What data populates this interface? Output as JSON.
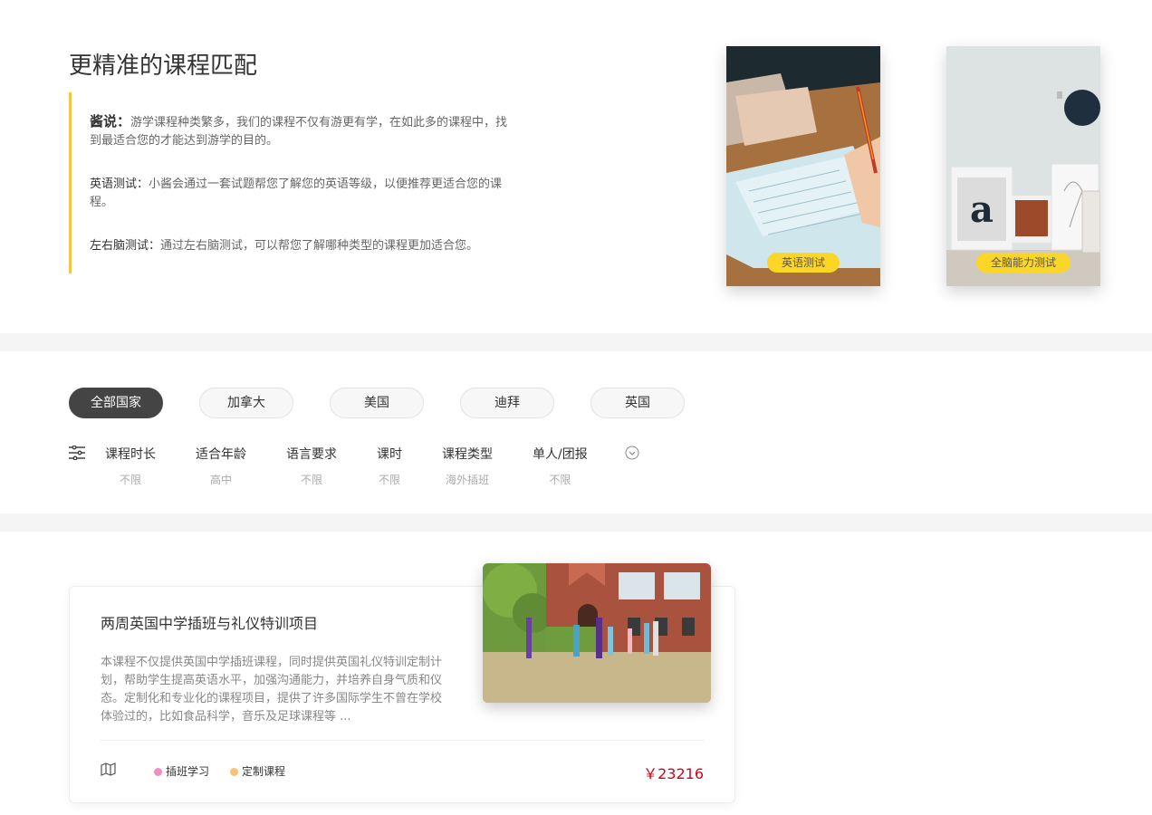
{
  "intro": {
    "title": "更精准的课程匹配",
    "p1_label": "酱说：",
    "p1_text": "游学课程种类繁多，我们的课程不仅有游更有学，在如此多的课程中，找到最适合您的才能达到游学的目的。",
    "p2_label": "英语测试：",
    "p2_text": "小酱会通过一套试题帮您了解您的英语等级，以便推荐更适合您的课程。",
    "p3_label": "左右脑测试：",
    "p3_text": "通过左右脑测试，可以帮您了解哪种类型的课程更加适合您。"
  },
  "tests": [
    {
      "label": "英语测试"
    },
    {
      "label": "全脑能力测试"
    }
  ],
  "countries": [
    "全部国家",
    "加拿大",
    "美国",
    "迪拜",
    "英国"
  ],
  "filters": [
    {
      "label": "课程时长",
      "value": "不限"
    },
    {
      "label": "适合年龄",
      "value": "高中"
    },
    {
      "label": "语言要求",
      "value": "不限"
    },
    {
      "label": "课时",
      "value": "不限"
    },
    {
      "label": "课程类型",
      "value": "海外插班"
    },
    {
      "label": "单人/团报",
      "value": "不限"
    }
  ],
  "course": {
    "title": "两周英国中学插班与礼仪特训项目",
    "description": "本课程不仅提供英国中学插班课程，同时提供英国礼仪特训定制计划，帮助学生提高英语水平，加强沟通能力，并培养自身气质和仪态。定制化和专业化的课程项目，提供了许多国际学生不曾在学校体验过的，比如食品科学，音乐及足球课程等 ...",
    "tags": [
      {
        "label": "插班学习",
        "color": "#f08fbf"
      },
      {
        "label": "定制课程",
        "color": "#f7c27a"
      }
    ],
    "price": "￥23216"
  },
  "colors": {
    "accent_yellow": "#fcd626",
    "quote_border": "#f4c542",
    "price_red": "#d0021b",
    "active_chip": "#444444"
  }
}
